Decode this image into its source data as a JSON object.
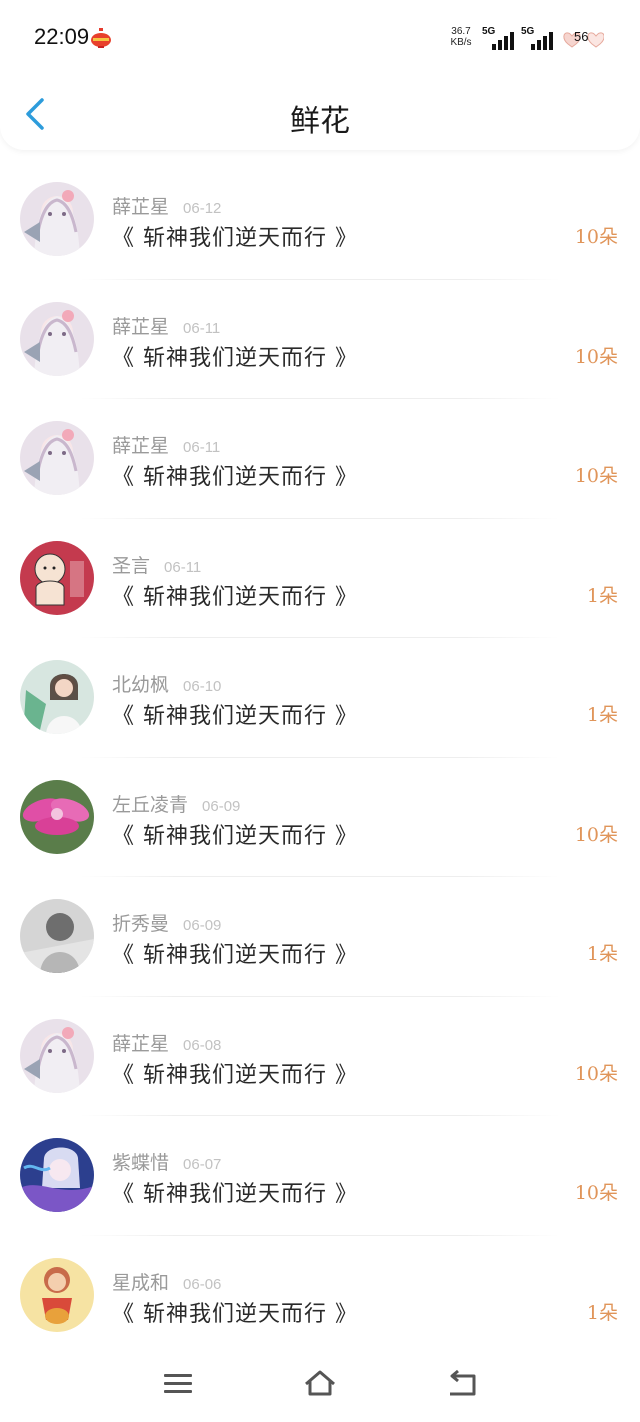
{
  "status_bar": {
    "time": "22:09",
    "net_speed_value": "36.7",
    "net_speed_unit": "KB/s",
    "sim1_label": "5G",
    "sim2_label": "5G",
    "battery": "56"
  },
  "header": {
    "title": "鲜花"
  },
  "colors": {
    "accent_blue": "#2d9cdb",
    "amount_orange": "#e0955a",
    "name_gray": "#9a9a9a",
    "date_gray": "#c2c2c2"
  },
  "records": [
    {
      "name": "薛芷星",
      "date": "06-12",
      "book": "《 斩神我们逆天而行 》",
      "amount": "10朵",
      "avatar": "anime-girl-pink"
    },
    {
      "name": "薛芷星",
      "date": "06-11",
      "book": "《 斩神我们逆天而行 》",
      "amount": "10朵",
      "avatar": "anime-girl-pink"
    },
    {
      "name": "薛芷星",
      "date": "06-11",
      "book": "《 斩神我们逆天而行 》",
      "amount": "10朵",
      "avatar": "anime-girl-pink"
    },
    {
      "name": "圣言",
      "date": "06-11",
      "book": "《 斩神我们逆天而行 》",
      "amount": "1朵",
      "avatar": "cartoon-baby-red"
    },
    {
      "name": "北幼枫",
      "date": "06-10",
      "book": "《 斩神我们逆天而行 》",
      "amount": "1朵",
      "avatar": "woman-photo"
    },
    {
      "name": "左丘凌青",
      "date": "06-09",
      "book": "《 斩神我们逆天而行 》",
      "amount": "10朵",
      "avatar": "pink-flower"
    },
    {
      "name": "折秀曼",
      "date": "06-09",
      "book": "《 斩神我们逆天而行 》",
      "amount": "1朵",
      "avatar": "grayscale-portrait"
    },
    {
      "name": "薛芷星",
      "date": "06-08",
      "book": "《 斩神我们逆天而行 》",
      "amount": "10朵",
      "avatar": "anime-girl-pink"
    },
    {
      "name": "紫蝶惜",
      "date": "06-07",
      "book": "《 斩神我们逆天而行 》",
      "amount": "10朵",
      "avatar": "anime-blue-purple"
    },
    {
      "name": "星成和",
      "date": "06-06",
      "book": "《 斩神我们逆天而行 》",
      "amount": "1朵",
      "avatar": "cartoon-lantern-kid"
    }
  ],
  "navigation": {
    "menu_icon": "menu-icon",
    "home_icon": "home-icon",
    "back_icon": "back-icon"
  }
}
